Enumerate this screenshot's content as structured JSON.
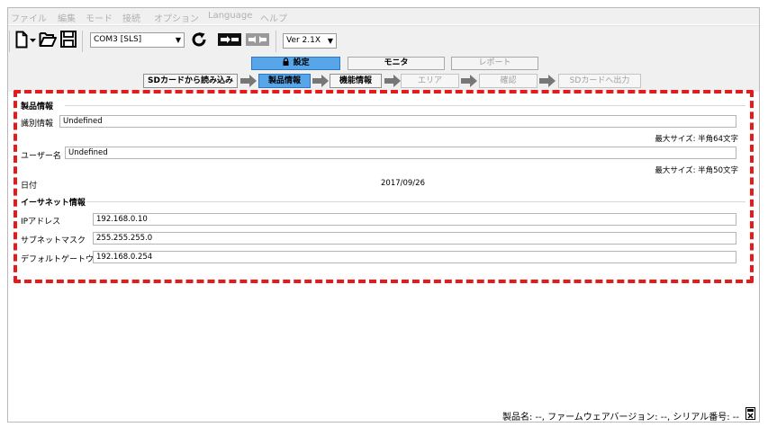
{
  "menu": [
    "ファイル",
    "編集",
    "モード",
    "接続",
    "オプション",
    "Language",
    "ヘルプ"
  ],
  "toolbar": {
    "port": "COM3 [SLS]",
    "version": "Ver 2.1X"
  },
  "tabs": [
    {
      "label": "設定",
      "state": "active"
    },
    {
      "label": "モニタ",
      "state": "normal"
    },
    {
      "label": "レポート",
      "state": "disabled"
    }
  ],
  "steps": [
    {
      "label": "SDカードから読み込み",
      "state": "normal"
    },
    {
      "label": "製品情報",
      "state": "active"
    },
    {
      "label": "機能情報",
      "state": "normal"
    },
    {
      "label": "エリア",
      "state": "disabled"
    },
    {
      "label": "確認",
      "state": "disabled"
    },
    {
      "label": "SDカードへ出力",
      "state": "disabled"
    }
  ],
  "product": {
    "section": "製品情報",
    "id_label": "識別情報",
    "id_value": "Undefined",
    "id_hint": "最大サイズ: 半角64文字",
    "user_label": "ユーザー名",
    "user_value": "Undefined",
    "user_hint": "最大サイズ: 半角50文字",
    "date_label": "日付",
    "date_value": "2017/09/26"
  },
  "ethernet": {
    "section": "イーサネット情報",
    "ip_label": "IPアドレス",
    "ip_value": "192.168.0.10",
    "mask_label": "サブネットマスク",
    "mask_value": "255.255.255.0",
    "gw_label": "デフォルトゲートウェイ",
    "gw_value": "192.168.0.254"
  },
  "status": "製品名: --, ファームウェアバージョン: --, シリアル番号: --",
  "colors": {
    "accent": "#58a6ea",
    "annotation": "#e31b1b"
  }
}
